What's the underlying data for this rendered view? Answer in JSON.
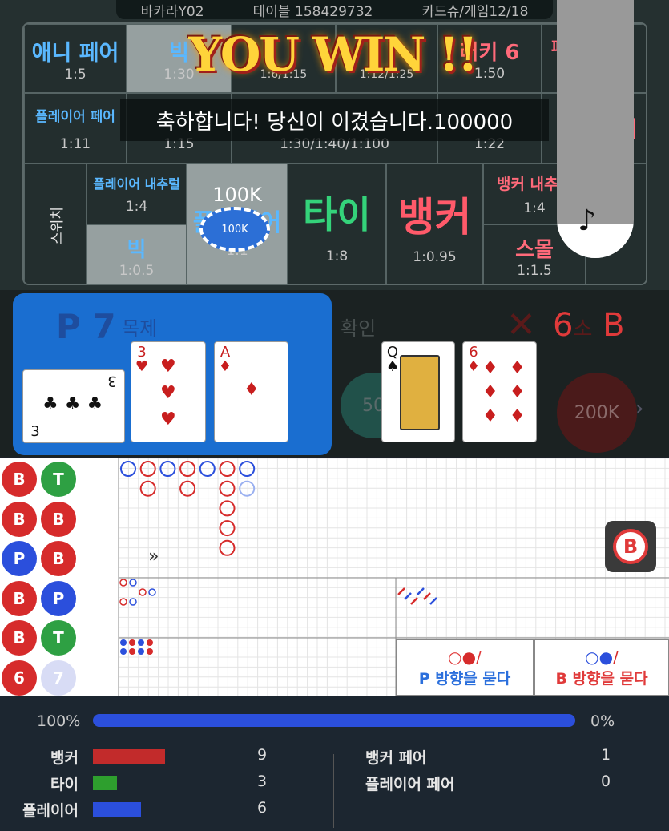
{
  "header": {
    "table": "바카라Y02",
    "table_id_label": "테이블",
    "table_id": "158429732",
    "shoe": "카드슈/게임12/18"
  },
  "win": {
    "banner": "YOU WIN !!",
    "message": "축하합니다! 당신이 이겼습니다.100000"
  },
  "bets": {
    "any_pair": {
      "name": "애니 페어",
      "ratio": "1:5"
    },
    "big": {
      "name": "빅",
      "ratio": "1:30"
    },
    "top_mid": {
      "ratio": "1:6/1:15"
    },
    "top_mid2": {
      "ratio": "1:12/1:25"
    },
    "lucky6": {
      "name": "러키 6",
      "ratio": "1:50"
    },
    "pair_right": {
      "name": "페"
    },
    "player_pair": {
      "name": "플레이어 페어",
      "ratio": "1:11"
    },
    "row2_b": {
      "ratio": "1:15"
    },
    "row2_mid": {
      "ratio": "1:30/1:40/1:100"
    },
    "row2_d": {
      "ratio": "1:22"
    },
    "row2_right": {
      "name": "어"
    },
    "switch": {
      "name": "스위치"
    },
    "player_dragon": {
      "name": "플레이어 내추럴",
      "ratio": "1:4"
    },
    "big2": {
      "name": "빅",
      "ratio": "1:0.5"
    },
    "player": {
      "name": "플레이어",
      "ratio": "1:1",
      "stake": "100K",
      "chip": "100K"
    },
    "tie": {
      "name": "타이",
      "ratio": "1:8"
    },
    "banker": {
      "name": "뱅커",
      "ratio": "1:0.95"
    },
    "banker_dragon": {
      "name": "뱅커 내추럴",
      "ratio": "1:4"
    },
    "small": {
      "name": "스몰",
      "ratio": "1:1.5"
    }
  },
  "controls": {
    "cancel": "목제",
    "confirm": "확인",
    "chip_left": "50",
    "chip_right": "200K"
  },
  "result": {
    "player_label": "P",
    "player_score": "7",
    "banker_label": "B",
    "banker_score": "6",
    "banker_tail": "소"
  },
  "cards": {
    "player": [
      {
        "rank": "3",
        "suit": "♣",
        "color": "black"
      },
      {
        "rank": "3",
        "suit": "♥",
        "color": "red"
      },
      {
        "rank": "A",
        "suit": "♦",
        "color": "red"
      }
    ],
    "banker": [
      {
        "rank": "Q",
        "suit": "♠",
        "color": "black"
      },
      {
        "rank": "6",
        "suit": "♦",
        "color": "red"
      }
    ]
  },
  "bead_road": [
    [
      "B",
      "T"
    ],
    [
      "B",
      "B"
    ],
    [
      "P",
      "B"
    ],
    [
      "B",
      "P"
    ],
    [
      "B",
      "T"
    ],
    [
      "6",
      "7"
    ]
  ],
  "ask": {
    "player": "P 방향을 묻다",
    "banker": "B 방향을 묻다"
  },
  "colors": {
    "banker": "#d62b2b",
    "player": "#2b4fdc",
    "tie": "#2ea043"
  },
  "stats": {
    "p_pct": "100%",
    "b_pct": "0%",
    "progress": 1.0,
    "rows": [
      {
        "label": "뱅커",
        "count": "9",
        "color": "#c22b2b",
        "len": 9
      },
      {
        "label": "타이",
        "count": "3",
        "color": "#2e9f2e",
        "len": 3
      },
      {
        "label": "플레이어",
        "count": "6",
        "color": "#2b4fdc",
        "len": 6
      }
    ],
    "pairs": [
      {
        "label": "뱅커 페어",
        "count": "1"
      },
      {
        "label": "플레이어 페어",
        "count": "0"
      }
    ]
  }
}
